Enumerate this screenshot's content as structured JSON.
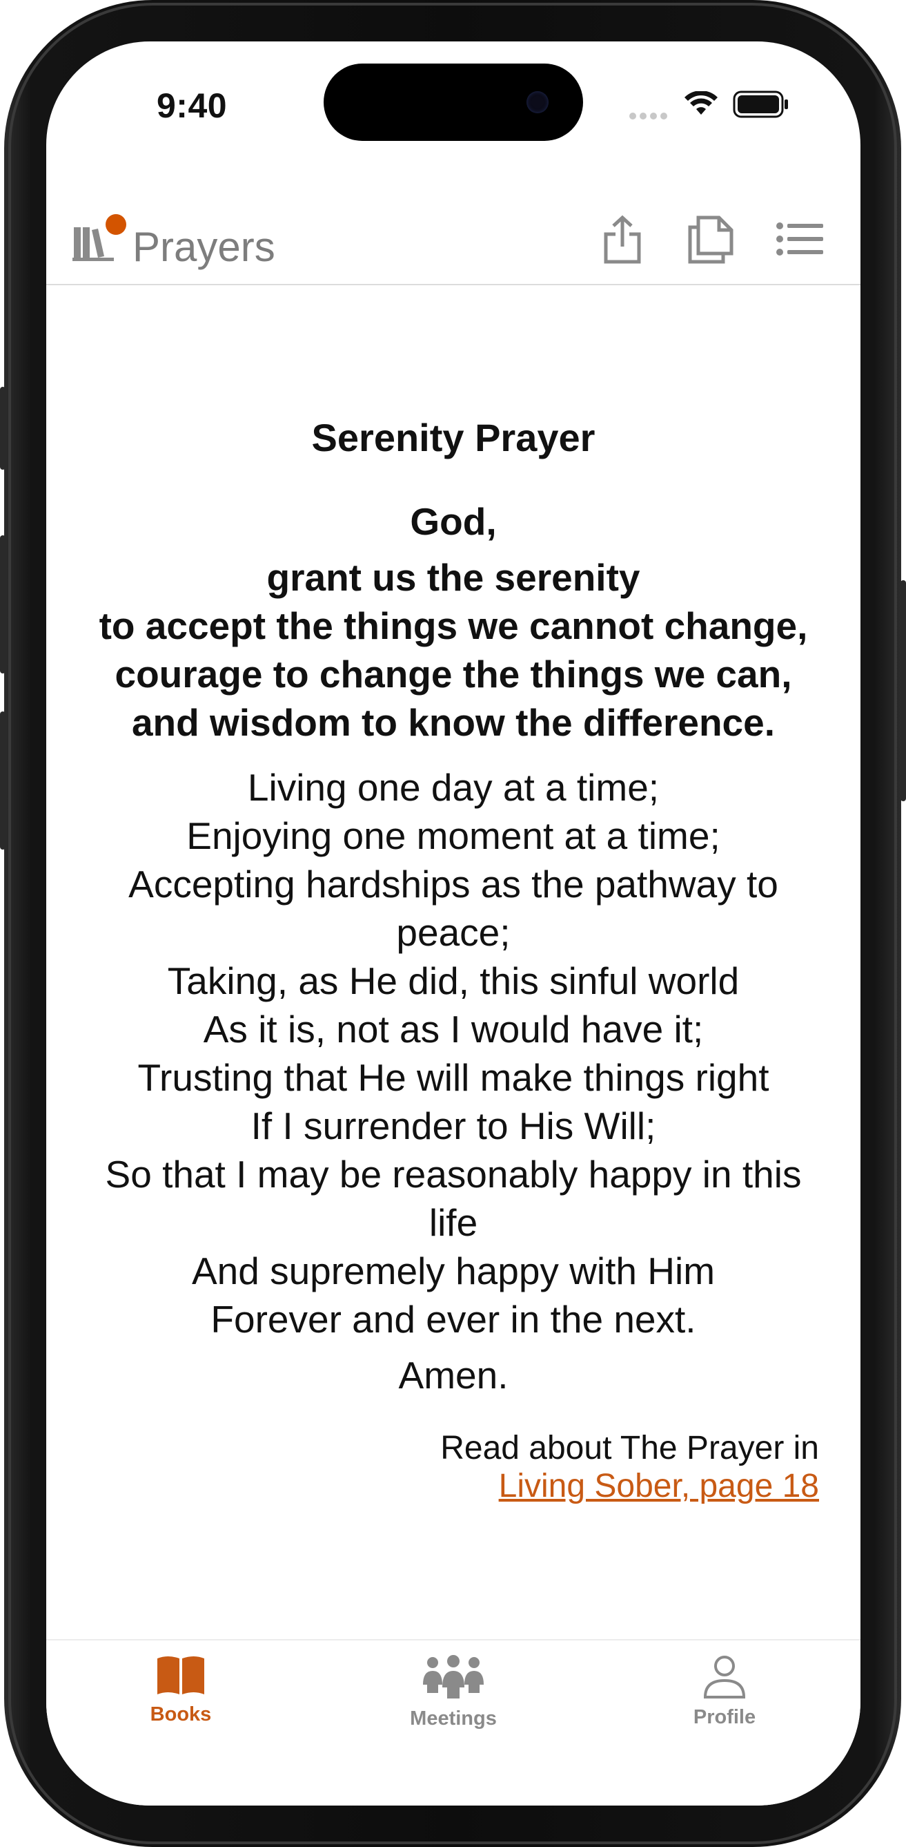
{
  "status_bar": {
    "time": "9:40"
  },
  "navbar": {
    "title": "Prayers",
    "icons": [
      "books-icon",
      "share-icon",
      "copy-icon",
      "list-icon"
    ]
  },
  "prayer": {
    "title": "Serenity Prayer",
    "bold_lines": [
      "God,",
      "grant us the serenity",
      "to accept the things we cannot change,",
      "courage to change the things we can,",
      "and wisdom to know the difference."
    ],
    "lines": [
      "Living one day at a time;",
      "Enjoying one moment at a time;",
      "Accepting hardships as the pathway to",
      "peace;",
      "Taking, as He did, this sinful world",
      "As it is, not as I would have it;",
      "Trusting that He will make things right",
      "If I surrender to His Will;",
      "So that I may be reasonably happy in this",
      "life",
      "And supremely happy with Him",
      "Forever and ever in the next."
    ],
    "amen": "Amen.",
    "read_about": "Read about The Prayer in",
    "read_link": "Living Sober, page 18"
  },
  "tabbar": {
    "tabs": [
      {
        "label": "Books",
        "icon": "open-book-icon",
        "active": true
      },
      {
        "label": "Meetings",
        "icon": "people-group-icon",
        "active": false
      },
      {
        "label": "Profile",
        "icon": "person-icon",
        "active": false
      }
    ]
  },
  "colors": {
    "accent": "#c85a14",
    "badge": "#d35400",
    "inactive": "#8a8a8a"
  }
}
